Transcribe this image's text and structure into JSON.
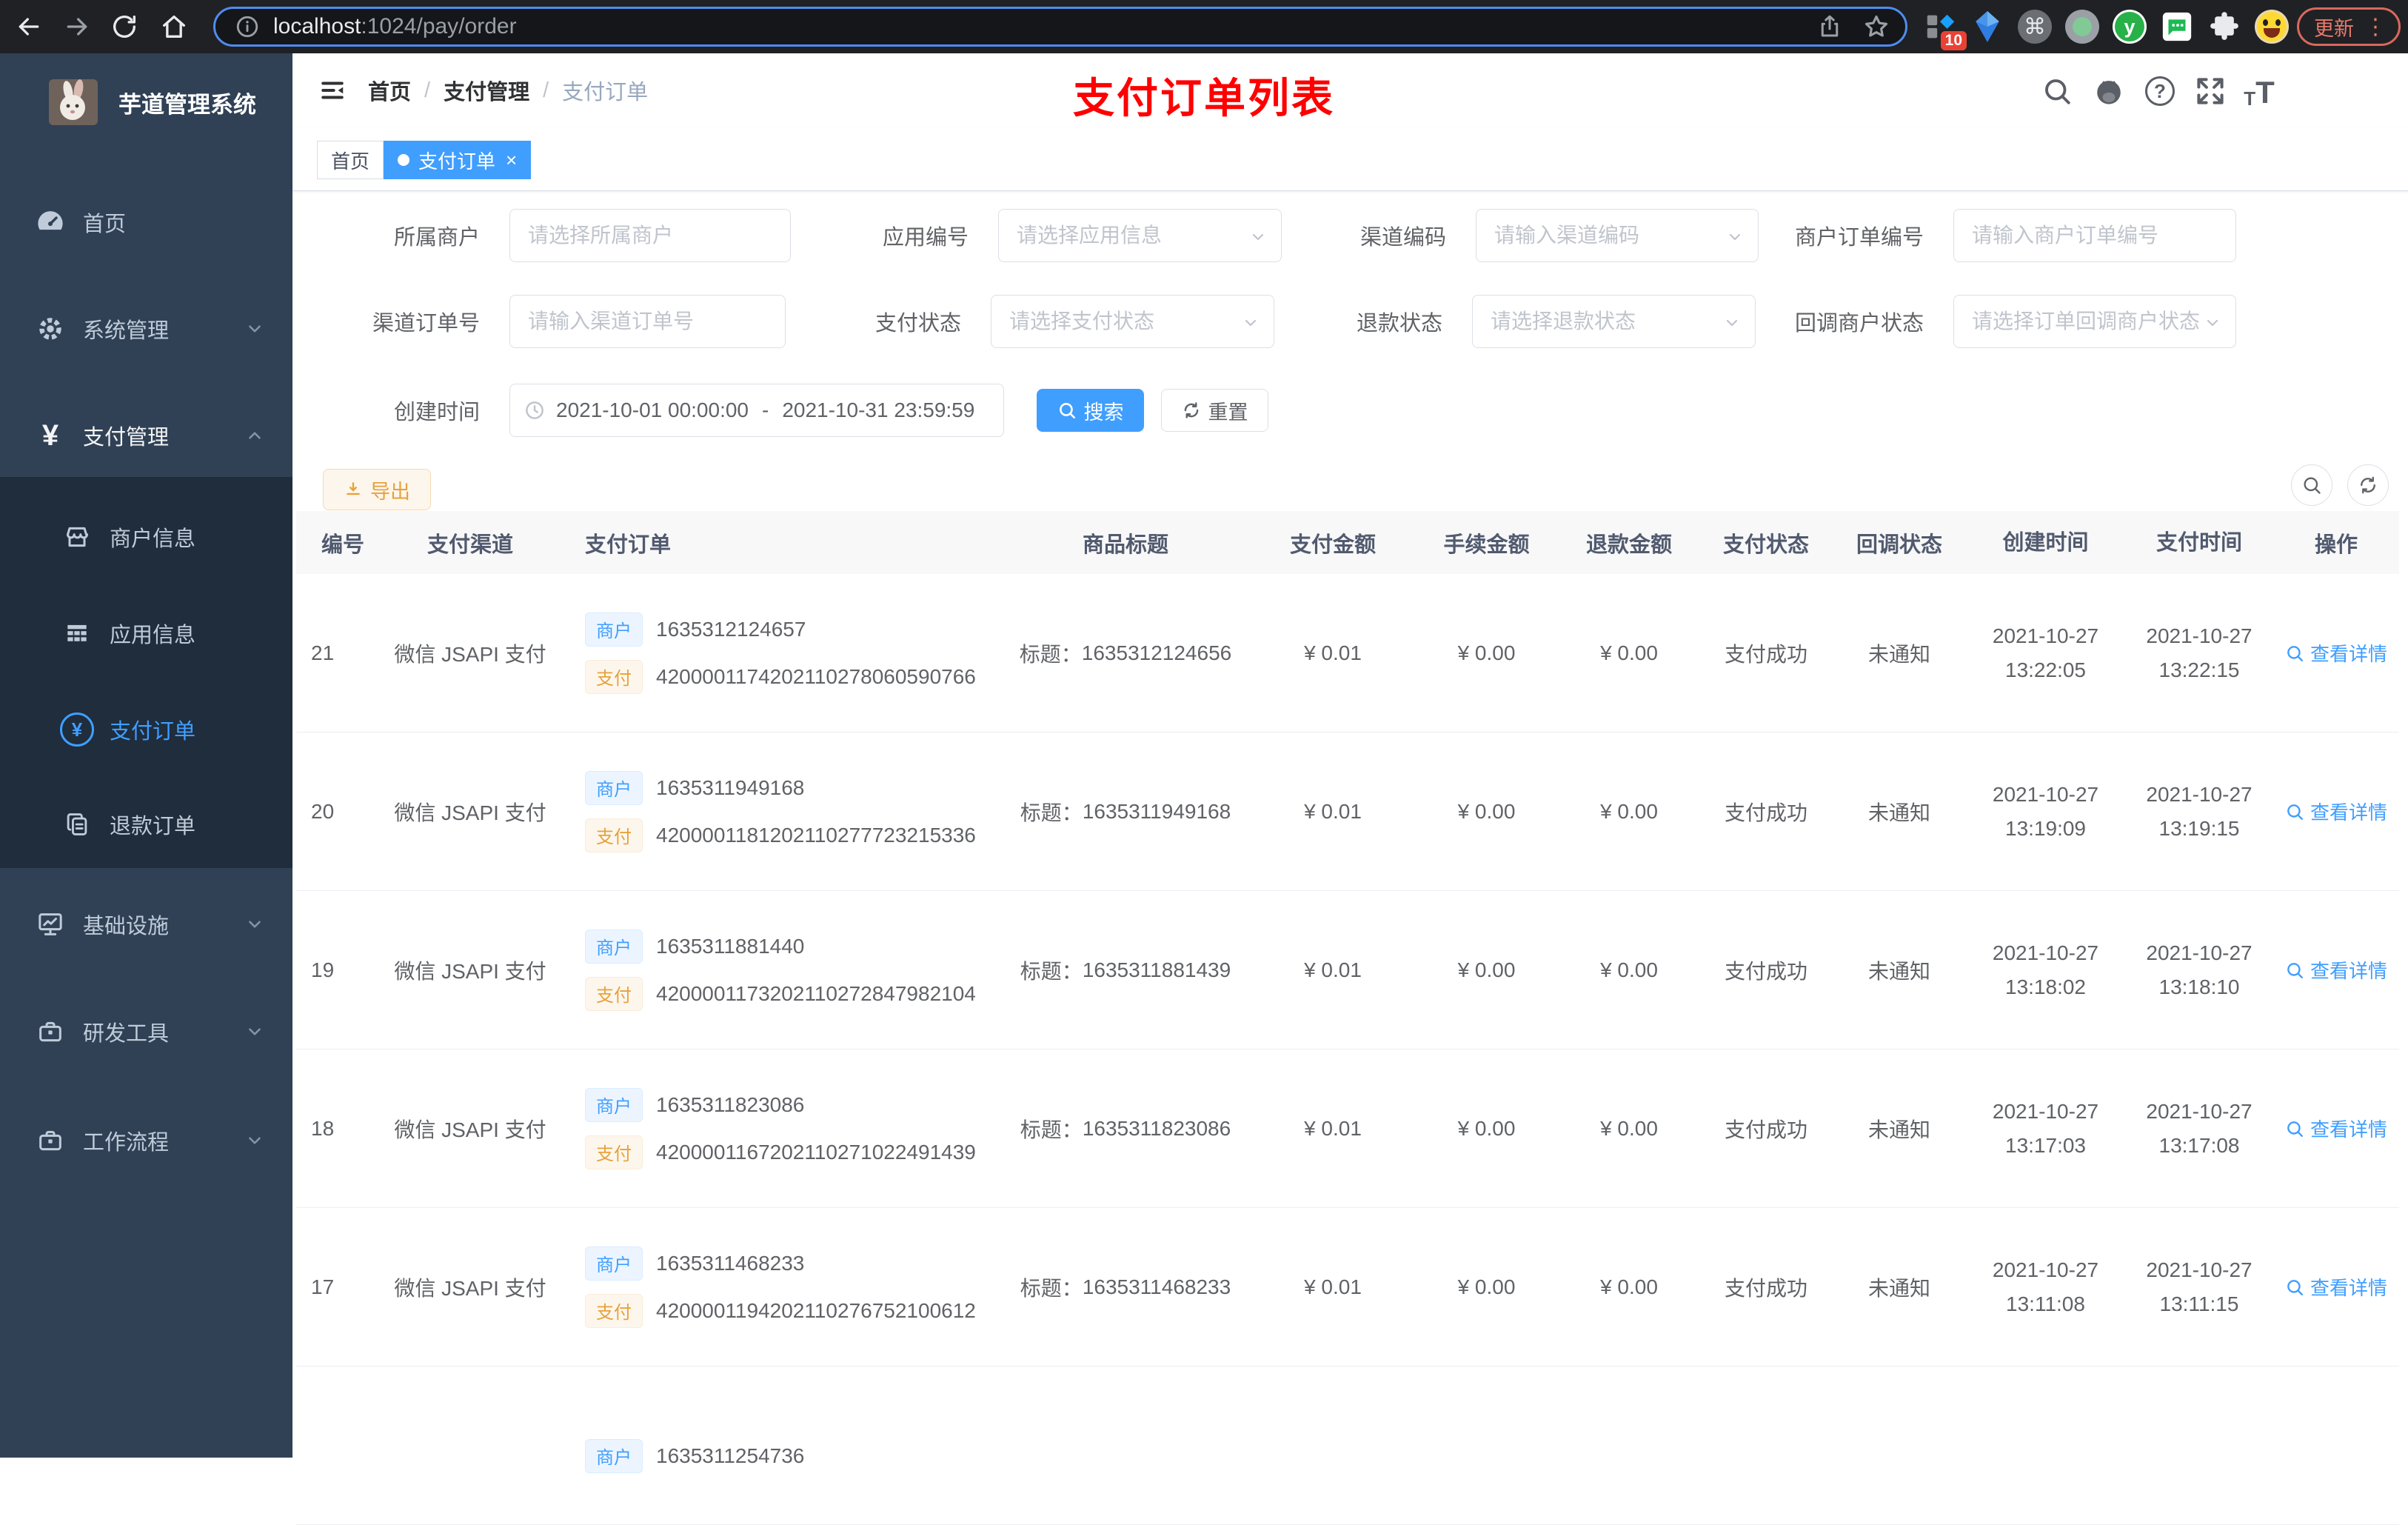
{
  "browser": {
    "url_host": "localhost",
    "url_path": ":1024/pay/order",
    "badge": "10",
    "update_label": "更新"
  },
  "icons": {
    "cmd": "⌘",
    "help_q": "?",
    "close": "×",
    "yen": "¥",
    "y_letter": "y",
    "font_small": "T",
    "font_big": "T",
    "kebab": "⋮"
  },
  "sidebar": {
    "title": "芋道管理系统",
    "menu": [
      {
        "label": "首页"
      },
      {
        "label": "系统管理"
      },
      {
        "label": "支付管理"
      },
      {
        "label": "商户信息"
      },
      {
        "label": "应用信息"
      },
      {
        "label": "支付订单"
      },
      {
        "label": "退款订单"
      },
      {
        "label": "基础设施"
      },
      {
        "label": "研发工具"
      },
      {
        "label": "工作流程"
      }
    ]
  },
  "breadcrumb": {
    "items": [
      "首页",
      "支付管理",
      "支付订单"
    ],
    "separator": "/"
  },
  "annotation": "支付订单列表",
  "tags": {
    "home": "首页",
    "current": "支付订单"
  },
  "filters": {
    "fields": [
      {
        "label": "所属商户",
        "placeholder": "请选择所属商户"
      },
      {
        "label": "应用编号",
        "placeholder": "请选择应用信息"
      },
      {
        "label": "渠道编码",
        "placeholder": "请输入渠道编码"
      },
      {
        "label": "商户订单编号",
        "placeholder": "请输入商户订单编号"
      },
      {
        "label": "渠道订单号",
        "placeholder": "请输入渠道订单号"
      },
      {
        "label": "支付状态",
        "placeholder": "请选择支付状态"
      },
      {
        "label": "退款状态",
        "placeholder": "请选择退款状态"
      },
      {
        "label": "回调商户状态",
        "placeholder": "请选择订单回调商户状态"
      }
    ],
    "date_label": "创建时间",
    "date_start": "2021-10-01 00:00:00",
    "date_separator": "-",
    "date_end": "2021-10-31 23:59:59",
    "search": "搜索",
    "reset": "重置"
  },
  "toolbar": {
    "export": "导出"
  },
  "table": {
    "headers": [
      "编号",
      "支付渠道",
      "支付订单",
      "商品标题",
      "支付金额",
      "手续金额",
      "退款金额",
      "支付状态",
      "回调状态",
      "创建时间",
      "支付时间",
      "操作"
    ],
    "tag_merchant": "商户",
    "tag_pay": "支付",
    "title_prefix": "标题：",
    "action": "查看详情",
    "rows": [
      {
        "id": "21",
        "channel": "微信 JSAPI 支付",
        "merchant_no": "1635312124657",
        "pay_no": "4200001174202110278060590766",
        "title": "1635312124656",
        "amount": "¥ 0.01",
        "fee": "¥ 0.00",
        "refund": "¥ 0.00",
        "status": "支付成功",
        "notify": "未通知",
        "created_date": "2021-10-27",
        "created_time": "13:22:05",
        "paid_date": "2021-10-27",
        "paid_time": "13:22:15"
      },
      {
        "id": "20",
        "channel": "微信 JSAPI 支付",
        "merchant_no": "1635311949168",
        "pay_no": "4200001181202110277723215336",
        "title": "1635311949168",
        "amount": "¥ 0.01",
        "fee": "¥ 0.00",
        "refund": "¥ 0.00",
        "status": "支付成功",
        "notify": "未通知",
        "created_date": "2021-10-27",
        "created_time": "13:19:09",
        "paid_date": "2021-10-27",
        "paid_time": "13:19:15"
      },
      {
        "id": "19",
        "channel": "微信 JSAPI 支付",
        "merchant_no": "1635311881440",
        "pay_no": "4200001173202110272847982104",
        "title": "1635311881439",
        "amount": "¥ 0.01",
        "fee": "¥ 0.00",
        "refund": "¥ 0.00",
        "status": "支付成功",
        "notify": "未通知",
        "created_date": "2021-10-27",
        "created_time": "13:18:02",
        "paid_date": "2021-10-27",
        "paid_time": "13:18:10"
      },
      {
        "id": "18",
        "channel": "微信 JSAPI 支付",
        "merchant_no": "1635311823086",
        "pay_no": "4200001167202110271022491439",
        "title": "1635311823086",
        "amount": "¥ 0.01",
        "fee": "¥ 0.00",
        "refund": "¥ 0.00",
        "status": "支付成功",
        "notify": "未通知",
        "created_date": "2021-10-27",
        "created_time": "13:17:03",
        "paid_date": "2021-10-27",
        "paid_time": "13:17:08"
      },
      {
        "id": "17",
        "channel": "微信 JSAPI 支付",
        "merchant_no": "1635311468233",
        "pay_no": "4200001194202110276752100612",
        "title": "1635311468233",
        "amount": "¥ 0.01",
        "fee": "¥ 0.00",
        "refund": "¥ 0.00",
        "status": "支付成功",
        "notify": "未通知",
        "created_date": "2021-10-27",
        "created_time": "13:11:08",
        "paid_date": "2021-10-27",
        "paid_time": "13:11:15"
      }
    ],
    "partial_row": {
      "merchant_no": "1635311254736"
    }
  }
}
